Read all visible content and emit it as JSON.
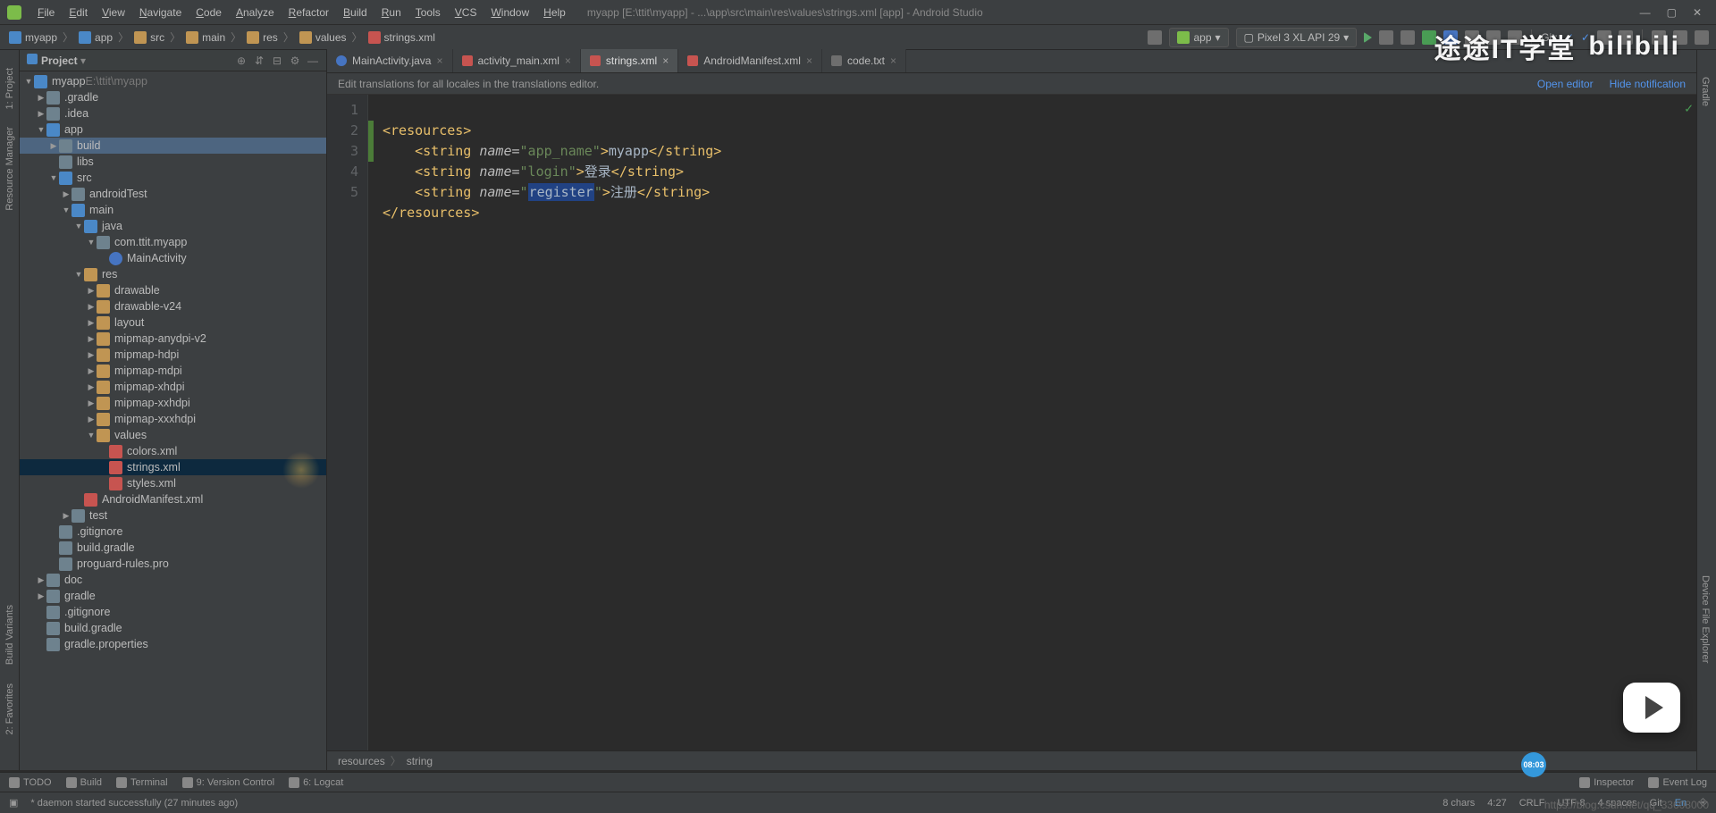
{
  "menubar": {
    "items": [
      "File",
      "Edit",
      "View",
      "Navigate",
      "Code",
      "Analyze",
      "Refactor",
      "Build",
      "Run",
      "Tools",
      "VCS",
      "Window",
      "Help"
    ],
    "title": "myapp [E:\\ttit\\myapp] - ...\\app\\src\\main\\res\\values\\strings.xml [app] - Android Studio"
  },
  "breadcrumbs": [
    "myapp",
    "app",
    "src",
    "main",
    "res",
    "values",
    "strings.xml"
  ],
  "run_config": {
    "module": "app",
    "device": "Pixel 3 XL API 29"
  },
  "git_label": "Git:",
  "project_header": "Project",
  "tree": [
    {
      "pad": 0,
      "arrow": "open",
      "icon": "root",
      "label": "myapp",
      "suffix": "E:\\ttit\\myapp"
    },
    {
      "pad": 1,
      "arrow": "closed",
      "icon": "folder",
      "label": ".gradle"
    },
    {
      "pad": 1,
      "arrow": "closed",
      "icon": "folder",
      "label": ".idea"
    },
    {
      "pad": 1,
      "arrow": "open",
      "icon": "root",
      "label": "app"
    },
    {
      "pad": 2,
      "arrow": "closed",
      "icon": "folder",
      "label": "build",
      "sel": "build"
    },
    {
      "pad": 2,
      "arrow": "none",
      "icon": "folder",
      "label": "libs"
    },
    {
      "pad": 2,
      "arrow": "open",
      "icon": "src",
      "label": "src"
    },
    {
      "pad": 3,
      "arrow": "closed",
      "icon": "folder",
      "label": "androidTest"
    },
    {
      "pad": 3,
      "arrow": "open",
      "icon": "src",
      "label": "main"
    },
    {
      "pad": 4,
      "arrow": "open",
      "icon": "src",
      "label": "java"
    },
    {
      "pad": 5,
      "arrow": "open",
      "icon": "folder",
      "label": "com.ttit.myapp"
    },
    {
      "pad": 6,
      "arrow": "none",
      "icon": "java",
      "label": "MainActivity"
    },
    {
      "pad": 4,
      "arrow": "open",
      "icon": "res",
      "label": "res"
    },
    {
      "pad": 5,
      "arrow": "closed",
      "icon": "res",
      "label": "drawable"
    },
    {
      "pad": 5,
      "arrow": "closed",
      "icon": "res",
      "label": "drawable-v24"
    },
    {
      "pad": 5,
      "arrow": "closed",
      "icon": "res",
      "label": "layout"
    },
    {
      "pad": 5,
      "arrow": "closed",
      "icon": "res",
      "label": "mipmap-anydpi-v2"
    },
    {
      "pad": 5,
      "arrow": "closed",
      "icon": "res",
      "label": "mipmap-hdpi"
    },
    {
      "pad": 5,
      "arrow": "closed",
      "icon": "res",
      "label": "mipmap-mdpi"
    },
    {
      "pad": 5,
      "arrow": "closed",
      "icon": "res",
      "label": "mipmap-xhdpi"
    },
    {
      "pad": 5,
      "arrow": "closed",
      "icon": "res",
      "label": "mipmap-xxhdpi"
    },
    {
      "pad": 5,
      "arrow": "closed",
      "icon": "res",
      "label": "mipmap-xxxhdpi"
    },
    {
      "pad": 5,
      "arrow": "open",
      "icon": "res",
      "label": "values"
    },
    {
      "pad": 6,
      "arrow": "none",
      "icon": "xml",
      "label": "colors.xml"
    },
    {
      "pad": 6,
      "arrow": "none",
      "icon": "xml",
      "label": "strings.xml",
      "sel": "sel"
    },
    {
      "pad": 6,
      "arrow": "none",
      "icon": "xml",
      "label": "styles.xml"
    },
    {
      "pad": 4,
      "arrow": "none",
      "icon": "xml",
      "label": "AndroidManifest.xml"
    },
    {
      "pad": 3,
      "arrow": "closed",
      "icon": "folder",
      "label": "test"
    },
    {
      "pad": 2,
      "arrow": "none",
      "icon": "folder",
      "label": ".gitignore"
    },
    {
      "pad": 2,
      "arrow": "none",
      "icon": "folder",
      "label": "build.gradle"
    },
    {
      "pad": 2,
      "arrow": "none",
      "icon": "folder",
      "label": "proguard-rules.pro"
    },
    {
      "pad": 1,
      "arrow": "closed",
      "icon": "folder",
      "label": "doc"
    },
    {
      "pad": 1,
      "arrow": "closed",
      "icon": "folder",
      "label": "gradle"
    },
    {
      "pad": 1,
      "arrow": "none",
      "icon": "folder",
      "label": ".gitignore"
    },
    {
      "pad": 1,
      "arrow": "none",
      "icon": "folder",
      "label": "build.gradle"
    },
    {
      "pad": 1,
      "arrow": "none",
      "icon": "folder",
      "label": "gradle.properties"
    }
  ],
  "tabs": [
    {
      "icon": "java",
      "label": "MainActivity.java",
      "active": false
    },
    {
      "icon": "xml",
      "label": "activity_main.xml",
      "active": false
    },
    {
      "icon": "xml",
      "label": "strings.xml",
      "active": true
    },
    {
      "icon": "xml",
      "label": "AndroidManifest.xml",
      "active": false
    },
    {
      "icon": "txt",
      "label": "code.txt",
      "active": false
    }
  ],
  "banner": {
    "text": "Edit translations for all locales in the translations editor.",
    "open": "Open editor",
    "hide": "Hide notification"
  },
  "code_lines": [
    "1",
    "2",
    "3",
    "4",
    "5"
  ],
  "code": {
    "resources_open": "<resources>",
    "l2_pre": "    <",
    "l2_tag": "string",
    "l2_sp": " ",
    "l2_attr": "name",
    "l2_eq": "=",
    "l2_val": "\"app_name\"",
    "l2_close": ">",
    "l2_text": "myapp",
    "l2_end": "</",
    "l2_endtag": "string",
    "l2_endclose": ">",
    "l3_pre": "    <",
    "l3_tag": "string",
    "l3_sp": " ",
    "l3_attr": "name",
    "l3_eq": "=",
    "l3_val": "\"login\"",
    "l3_close": ">",
    "l3_text": "登录",
    "l3_end": "</",
    "l3_endtag": "string",
    "l3_endclose": ">",
    "l4_pre": "    <",
    "l4_tag": "string",
    "l4_sp": " ",
    "l4_attr": "name",
    "l4_eq": "=",
    "l4_val_open": "\"",
    "l4_val_hl": "register",
    "l4_val_close": "\"",
    "l4_close": ">",
    "l4_text": "注册",
    "l4_end": "</",
    "l4_endtag": "string",
    "l4_endclose": ">",
    "resources_close": "</resources>"
  },
  "editor_crumb": [
    "resources",
    "string"
  ],
  "left_gutter": [
    "1: Project",
    "Resource Manager",
    "Build Variants",
    "2: Favorites"
  ],
  "right_gutter": {
    "top": "Gradle",
    "bottom": "Device File Explorer"
  },
  "bottom_tools": {
    "left": [
      "TODO",
      "Build",
      "Terminal",
      "9: Version Control",
      "6: Logcat"
    ],
    "right": [
      "Inspector",
      "Event Log"
    ]
  },
  "status": {
    "msg": "* daemon started successfully (27 minutes ago)",
    "chars": "8 chars",
    "pos": "4:27",
    "eol": "CRLF",
    "enc": "UTF-8",
    "spaces": "4 spaces",
    "git": "Git"
  },
  "watermark": {
    "cn": "途途IT学堂",
    "bili": "bilibili"
  },
  "time_pill": "08:03",
  "csdn": "https://blog.csdn.net/qq_33608000"
}
